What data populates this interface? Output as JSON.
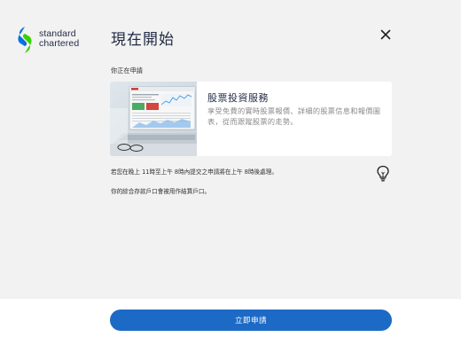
{
  "brand": {
    "name_line1": "standard",
    "name_line2": "chartered",
    "color_blue": "#0473ea",
    "color_green": "#38d200"
  },
  "header": {
    "title": "現在開始",
    "close_icon": "close-icon"
  },
  "section_label": "你正在申請",
  "product": {
    "title": "股票投資服務",
    "description": "享受免費的實時股票報價、詳細的股票信息和報價圖表，從而跟蹤股票的走勢。",
    "image_icon": "laptop-stock-dashboard-image"
  },
  "notes": {
    "line1": "若您在晚上 11時至上午 8時內提交之申請將在上午 8時後處理。",
    "line2": "你的綜合存款戶口會被用作結算戶口。",
    "tip_icon": "lightbulb-icon"
  },
  "footer": {
    "apply_label": "立即申請",
    "button_color": "#1c6ac6"
  }
}
